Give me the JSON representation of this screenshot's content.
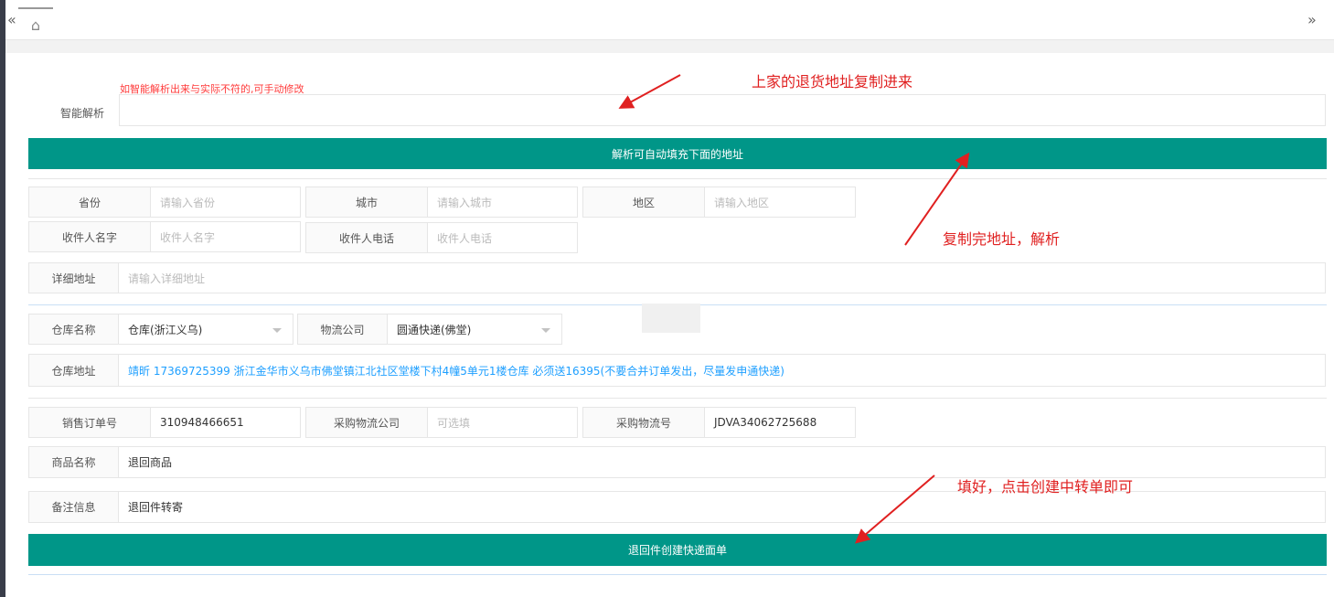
{
  "nav": {
    "prev": "«",
    "next": "»",
    "home_icon": "⌂"
  },
  "parse": {
    "hint": "如智能解析出来与实际不符的,可手动修改",
    "label": "智能解析",
    "value": "",
    "button": "解析可自动填充下面的地址"
  },
  "address": {
    "province_label": "省份",
    "province_ph": "请输入省份",
    "city_label": "城市",
    "city_ph": "请输入城市",
    "district_label": "地区",
    "district_ph": "请输入地区",
    "name_label": "收件人名字",
    "name_ph": "收件人名字",
    "phone_label": "收件人电话",
    "phone_ph": "收件人电话",
    "detail_label": "详细地址",
    "detail_ph": "请输入详细地址"
  },
  "warehouse": {
    "name_label": "仓库名称",
    "name_value": "仓库(浙江义乌)",
    "logistics_label": "物流公司",
    "logistics_value": "圆通快递(佛堂)",
    "addr_label": "仓库地址",
    "addr_value": "靖昕 17369725399 浙江金华市义乌市佛堂镇江北社区堂楼下村4幢5单元1楼仓库 必须送16395(不要合并订单发出，尽量发申通快递)"
  },
  "order": {
    "sales_no_label": "销售订单号",
    "sales_no_value": "310948466651",
    "purchase_company_label": "采购物流公司",
    "purchase_company_ph": "可选填",
    "purchase_no_label": "采购物流号",
    "purchase_no_value": "JDVA34062725688",
    "goods_label": "商品名称",
    "goods_value": "退回商品",
    "remark_label": "备注信息",
    "remark_value": "退回件转寄",
    "create_button": "退回件创建快递面单"
  },
  "annotations": {
    "a1": "上家的退货地址复制进来",
    "a2": "复制完地址，解析",
    "a3": "填好，点击创建中转单即可"
  },
  "colors": {
    "accent": "#009688",
    "annotation": "#e02020",
    "link": "#1e9fff"
  }
}
